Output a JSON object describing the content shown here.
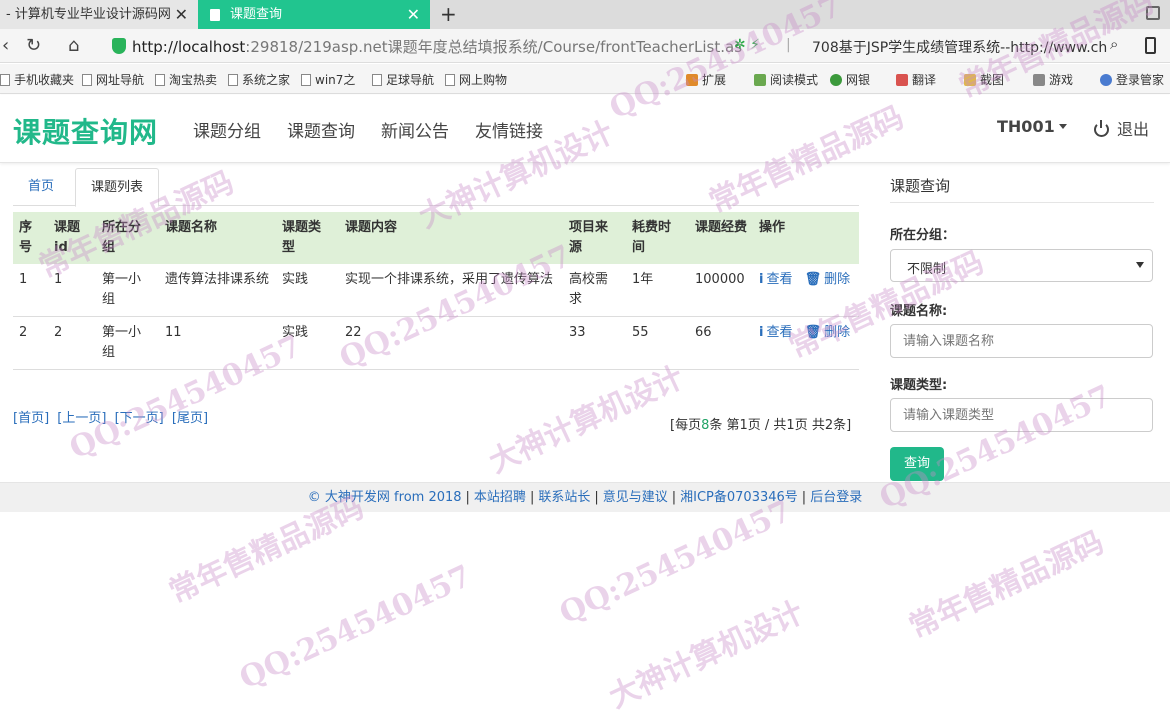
{
  "browser": {
    "tabs": [
      {
        "label": "- 计算机专业毕业设计源码网",
        "close": "✕"
      },
      {
        "label": "课题查询",
        "close": "✕"
      }
    ],
    "new_tab": "+",
    "url_host": "http://localhost",
    "url_rest": ":29818/219asp.net课题年度总结填报系统/Course/frontTeacherList.as",
    "search_hint": "708基于JSP学生成绩管理系统--http://www.ch",
    "bookmarks": [
      "手机收藏夹",
      "网址导航",
      "淘宝热卖",
      "系统之家",
      "win7之",
      "足球导航",
      "网上购物"
    ],
    "toolbar_right": [
      "扩展",
      "阅读模式",
      "网银",
      "翻译",
      "截图",
      "游戏",
      "登录管家"
    ]
  },
  "site": {
    "brand": "课题查询网",
    "nav": [
      "课题分组",
      "课题查询",
      "新闻公告",
      "友情链接"
    ],
    "user": "TH001",
    "logout": "退出"
  },
  "tabs": {
    "home": "首页",
    "list": "课题列表"
  },
  "table": {
    "headers": [
      "序号",
      "课题id",
      "所在分组",
      "课题名称",
      "课题类型",
      "课题内容",
      "项目来源",
      "耗费时间",
      "课题经费",
      "操作"
    ],
    "rows": [
      [
        "1",
        "1",
        "第一小组",
        "遗传算法排课系统",
        "实践",
        "实现一个排课系统，采用了遗传算法",
        "高校需求",
        "1年",
        "100000"
      ],
      [
        "2",
        "2",
        "第一小组",
        "11",
        "实践",
        "22",
        "33",
        "55",
        "66"
      ]
    ],
    "view_label": "查看",
    "delete_label": "删除"
  },
  "pager": {
    "first": "[首页]",
    "prev": "[上一页]",
    "next": "[下一页]",
    "last": "[尾页]",
    "info_a": "[每页",
    "per_page": "8",
    "info_b": "条 第",
    "current": "1",
    "info_c": "页 / 共1页 共2条]"
  },
  "sidebar": {
    "title": "课题查询",
    "group_label": "所在分组：",
    "group_value": "不限制",
    "name_label": "课题名称:",
    "name_placeholder": "请输入课题名称",
    "type_label": "课题类型:",
    "type_placeholder": "请输入课题类型",
    "search_button": "查询"
  },
  "footer": {
    "copyright": "© 大神开发网 from 2018",
    "links": [
      "本站招聘",
      "联系站长",
      "意见与建议",
      "湘ICP备0703346号",
      "后台登录"
    ]
  },
  "watermark": {
    "qq": "QQ:254540457",
    "design": "大神计算机设计",
    "source": "常年售精品源码"
  },
  "colors": {
    "accent": "#21b88a",
    "link": "#2a6ebb",
    "table_header": "#dff0d8"
  }
}
